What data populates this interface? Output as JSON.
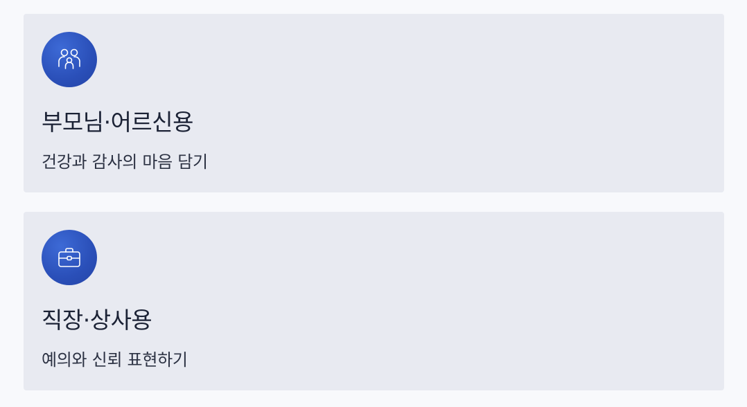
{
  "cards": [
    {
      "icon": "family-icon",
      "title": "부모님·어르신용",
      "description": "건강과 감사의 마음 담기"
    },
    {
      "icon": "briefcase-icon",
      "title": "직장·상사용",
      "description": "예의와 신뢰 표현하기"
    }
  ],
  "colors": {
    "background": "#f8f9fc",
    "card": "#e8eaf1",
    "icon_circle": "#2a4fb8",
    "title": "#1b2235",
    "description": "#2b3142"
  }
}
